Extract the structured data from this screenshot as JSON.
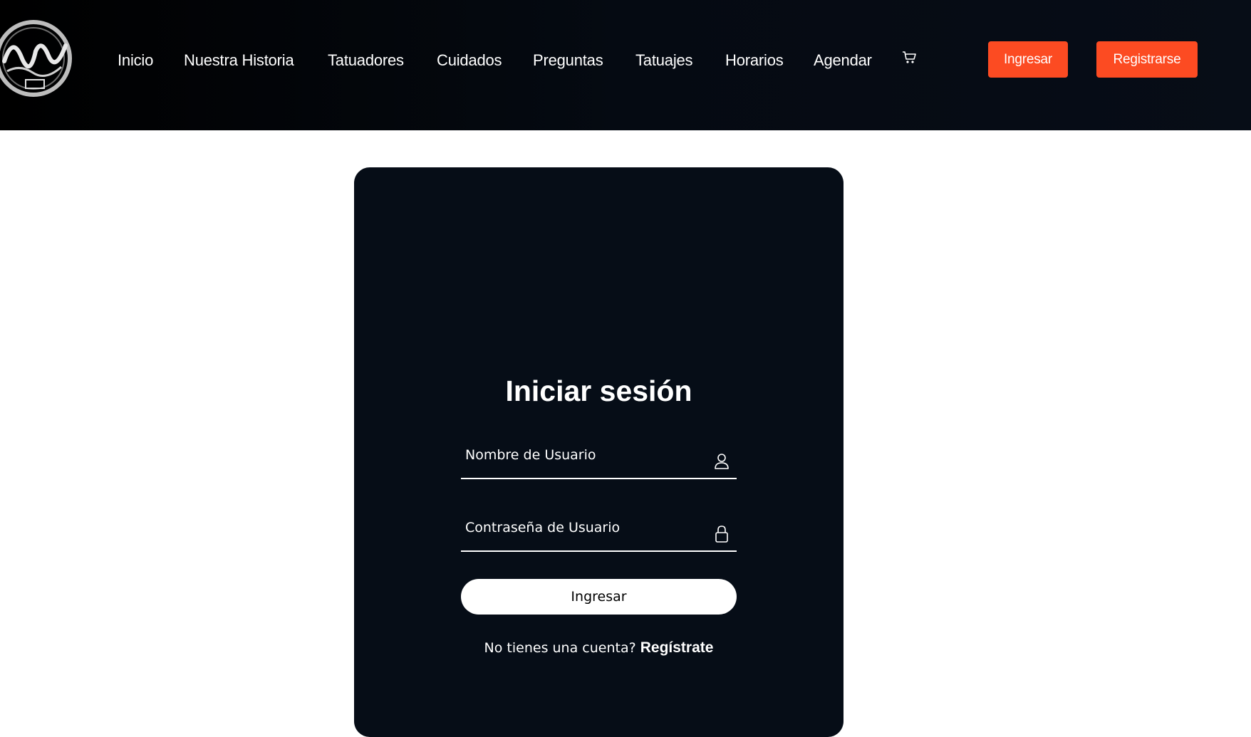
{
  "header": {
    "logo_alt": "Zaiko Tattoo",
    "nav": [
      {
        "label": "Inicio"
      },
      {
        "label": "Nuestra Historia"
      },
      {
        "label": "Tatuadores"
      },
      {
        "label": "Cuidados"
      },
      {
        "label": "Preguntas"
      },
      {
        "label": "Tatuajes"
      },
      {
        "label": "Horarios"
      },
      {
        "label": "Agendar"
      }
    ],
    "cart_icon": "cart-icon",
    "login_label": "Ingresar",
    "register_label": "Registrarse",
    "accent_color": "#fc4b22"
  },
  "login": {
    "title": "Iniciar sesión",
    "username_placeholder": "Nombre de Usuario",
    "username_icon": "user-icon",
    "password_placeholder": "Contraseña de Usuario",
    "password_icon": "lock-icon",
    "submit_label": "Ingresar",
    "signup_prompt": "No tienes una cuenta?",
    "signup_link": "Regístrate"
  }
}
